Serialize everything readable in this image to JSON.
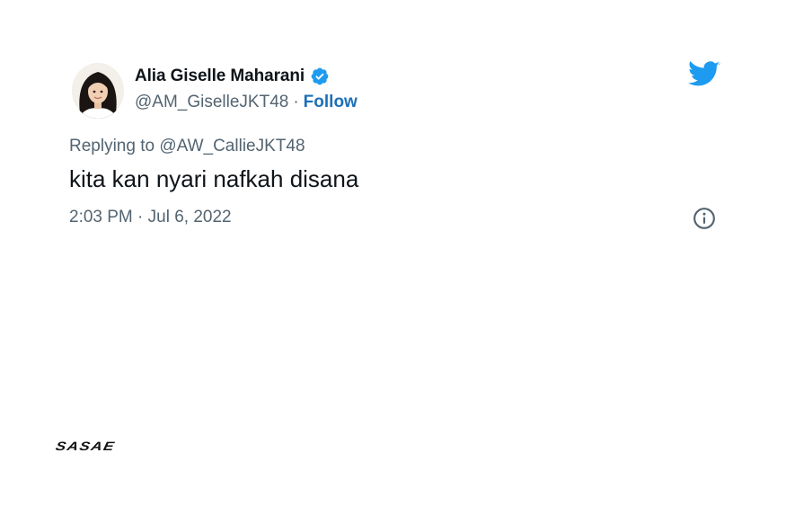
{
  "tweet": {
    "display_name": "Alia Giselle Maharani",
    "handle": "@AM_GiselleJKT48",
    "separator": "·",
    "follow_label": "Follow",
    "replying_to": "Replying to @AW_CallieJKT48",
    "text": "kita kan nyari nafkah disana",
    "timestamp": "2:03 PM · Jul 6, 2022",
    "verified_icon": "verified-badge-icon",
    "logo_icon": "twitter-bird-icon",
    "info_icon": "info-circle-icon"
  },
  "brand": {
    "logo_text": "SASAE"
  },
  "colors": {
    "twitter_blue": "#1d9bf0",
    "follow_link": "#1d70b8",
    "secondary_text": "#536471",
    "primary_text": "#0f1419"
  }
}
